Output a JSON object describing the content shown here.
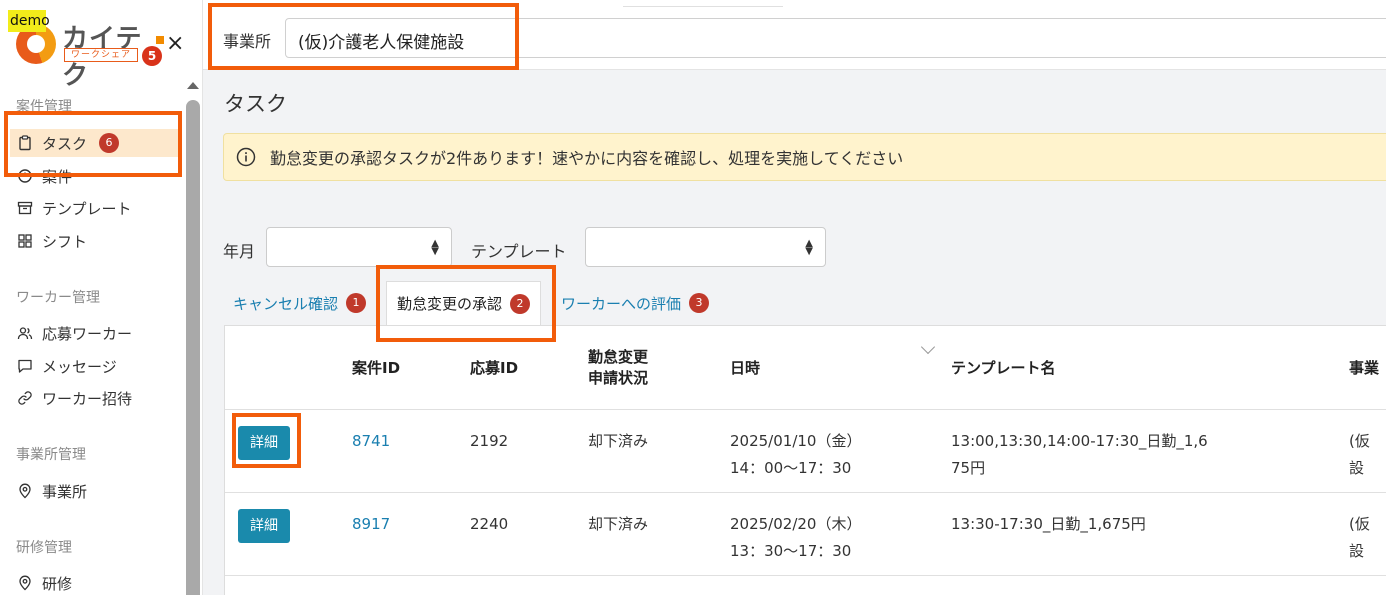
{
  "sidebar": {
    "demo": "demo",
    "logo_text": "カイテク",
    "logo_sub": "ワークシェア",
    "logo_badge": "5",
    "close": "×",
    "groups": {
      "case": "案件管理",
      "worker": "ワーカー管理",
      "office": "事業所管理",
      "training": "研修管理"
    },
    "items": [
      {
        "label": "タスク",
        "badge": "6",
        "icon": "clipboard-icon"
      },
      {
        "label": "案件",
        "icon": "clock-icon"
      },
      {
        "label": "テンプレート",
        "icon": "archive-icon"
      },
      {
        "label": "シフト",
        "icon": "grid-icon"
      },
      {
        "label": "応募ワーカー",
        "icon": "users-icon"
      },
      {
        "label": "メッセージ",
        "icon": "message-icon"
      },
      {
        "label": "ワーカー招待",
        "icon": "link-icon"
      },
      {
        "label": "事業所",
        "icon": "map-pin-icon"
      },
      {
        "label": "研修",
        "icon": "map-pin-icon"
      }
    ]
  },
  "topbar": {
    "office_label": "事業所",
    "office_value": "(仮)介護老人保健施設"
  },
  "main": {
    "title": "タスク",
    "alert": "勤怠変更の承認タスクが2件あります！速やかに内容を確認し、処理を実施してください",
    "filters": {
      "month_label": "年月",
      "template_label": "テンプレート"
    },
    "tabs": [
      {
        "label": "キャンセル確認",
        "badge": "1"
      },
      {
        "label": "勤怠変更の承認",
        "badge": "2"
      },
      {
        "label": "ワーカーへの評価",
        "badge": "3"
      }
    ],
    "table": {
      "headers": {
        "case_id": "案件ID",
        "app_id": "応募ID",
        "status_1": "勤怠変更",
        "status_2": "申請状況",
        "datetime": "日時",
        "template": "テンプレート名",
        "office": "事業"
      },
      "detail_label": "詳細",
      "rows": [
        {
          "case_id": "8741",
          "app_id": "2192",
          "status": "却下済み",
          "date": "2025/01/10（金）",
          "time": "14：00～17：30",
          "template_1": "13:00,13:30,14:00-17:30_日勤_1,6",
          "template_2": "75円",
          "office_1": "(仮",
          "office_2": "設"
        },
        {
          "case_id": "8917",
          "app_id": "2240",
          "status": "却下済み",
          "date": "2025/02/20（木）",
          "time": "13：30～17：30",
          "template_1": "13:30-17:30_日勤_1,675円",
          "template_2": "",
          "office_1": "(仮",
          "office_2": "設"
        }
      ]
    }
  },
  "colors": {
    "highlight": "#f25c0a",
    "link": "#1a7fb0",
    "button": "#1a8aac",
    "badge": "#c0392b",
    "alert_bg": "#fff3cd",
    "active_nav": "#fde8cc"
  }
}
